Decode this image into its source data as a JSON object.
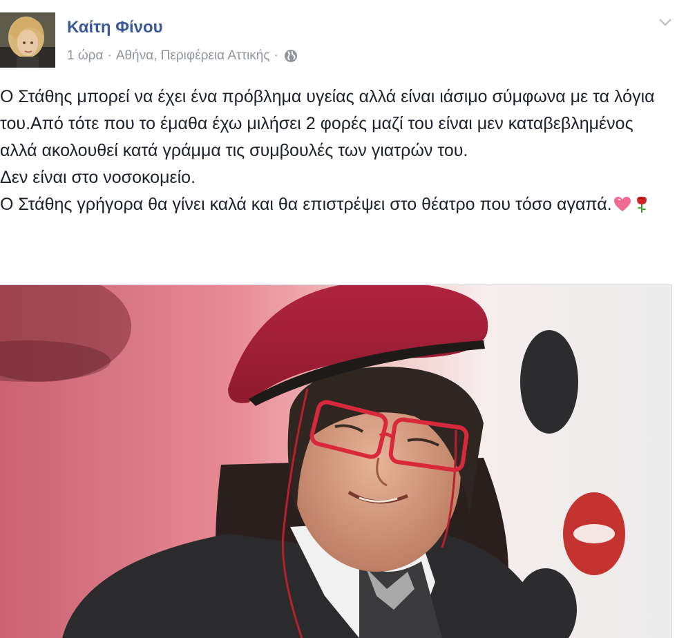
{
  "post": {
    "author": "Καίτη Φίνου",
    "time": "1 ώρα",
    "separator": "·",
    "location": "Αθήνα, Περιφέρεια Αττικής",
    "separator2": "·",
    "privacy_icon": "globe-icon",
    "menu_icon": "chevron-down-icon",
    "text_lines": [
      "Ο Στάθης μπορεί να έχει ένα πρόβλημα υγείας αλλά είναι ιάσιμο σύμφωνα με τα λόγια του.Από τότε που το έμαθα έχω μιλήσει 2 φορές μαζί του είναι μεν καταβεβλημένος αλλά ακολουθεί κατά γράμμα τις συμβουλές των γιατρών του.",
      "Δεν είναι στο νοσοκομείο.",
      "Ο Στάθης γρήγορα θα γίνει καλά και θα επιστρέψει στο θέατρο που τόσο αγαπά."
    ],
    "emojis": [
      "heart-emoji",
      "rose-emoji"
    ],
    "colors": {
      "author": "#3b5998",
      "meta": "#90949c",
      "text": "#1d2129"
    }
  }
}
